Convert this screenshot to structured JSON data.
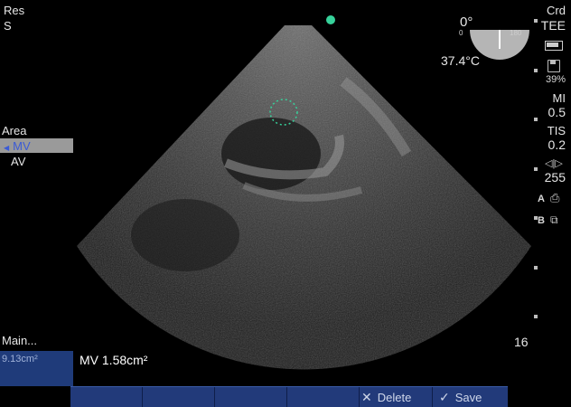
{
  "top_left": {
    "line1": "Res",
    "line2": "S"
  },
  "top_right": {
    "mode": "Crd",
    "probe": "TEE"
  },
  "angle": {
    "value": "0°",
    "min": "0",
    "max": "180"
  },
  "temperature": "37.4°C",
  "power": "39%",
  "mi": {
    "label": "MI",
    "value": "0.5"
  },
  "tis": {
    "label": "TIS",
    "value": "0.2"
  },
  "gain": "255",
  "marker_a": "A",
  "marker_b": "B",
  "left_menu": {
    "title": "Area",
    "items": [
      {
        "label": "MV",
        "selected": true
      },
      {
        "label": "AV",
        "selected": false
      }
    ]
  },
  "main_label": "Main...",
  "prev_measure": "9.13cm²",
  "measurement": "MV 1.58cm²",
  "depth": "16",
  "bottom_bar": {
    "delete_label": "Delete",
    "save_label": "Save"
  },
  "colors": {
    "bar": "#223a7a",
    "marker": "#37d29b",
    "trace": "#37d29b",
    "selected": "#9a9a9a"
  }
}
